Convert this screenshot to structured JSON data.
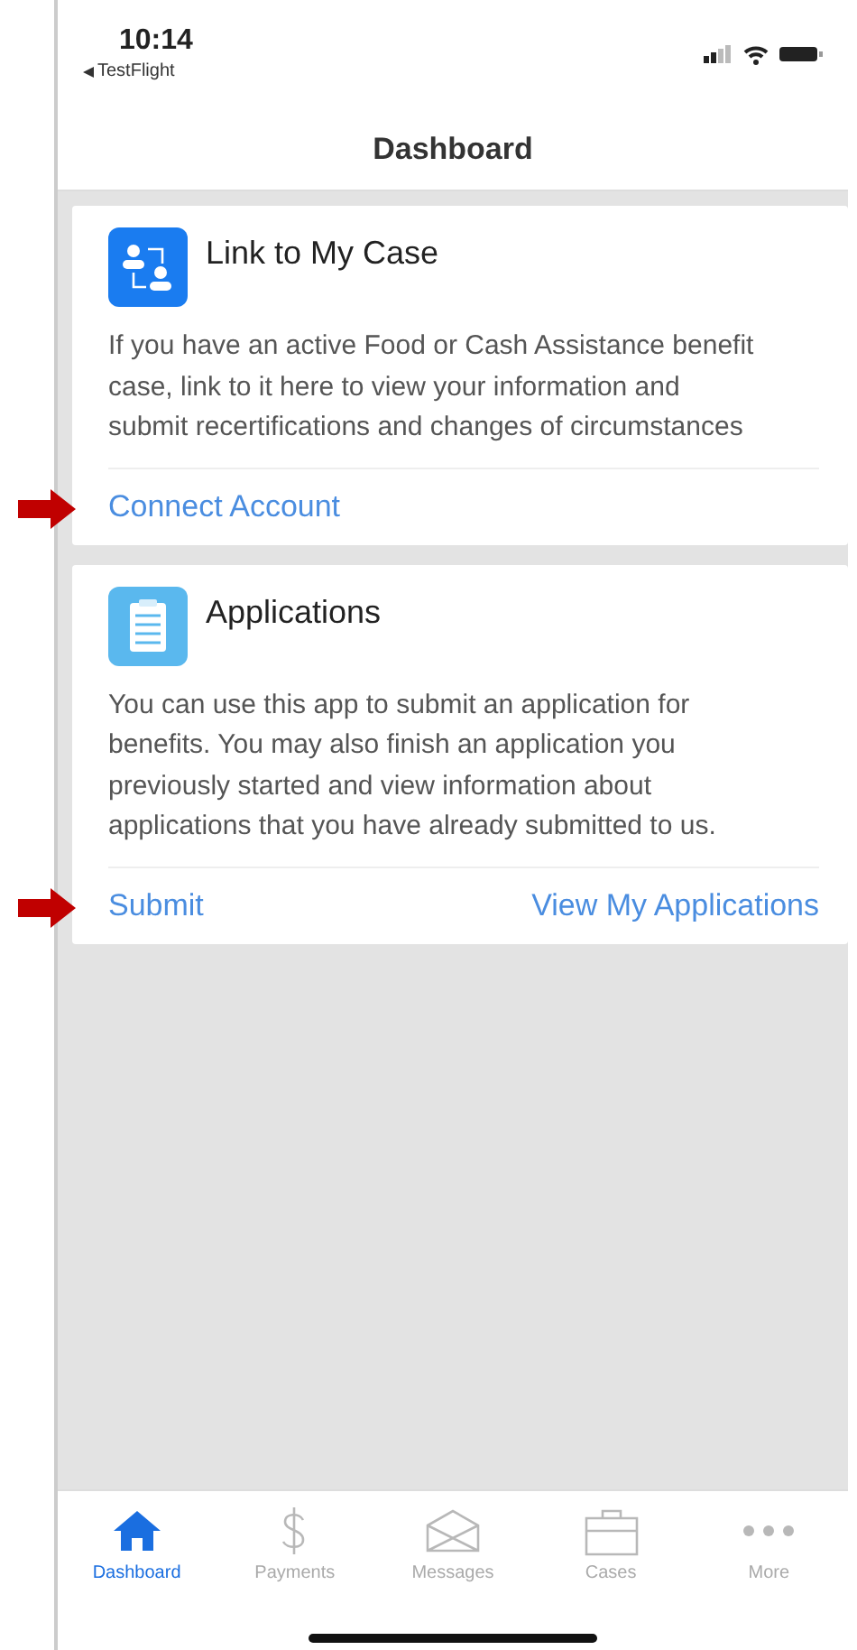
{
  "status_bar": {
    "time": "10:14",
    "back_label": "TestFlight"
  },
  "nav_bar": {
    "title": "Dashboard"
  },
  "cards": [
    {
      "title": "Link to My Case",
      "body": "If you have an active Food or Cash Assistance benefit case, link to it here to view your information and submit recertifications and changes of circumstances",
      "actions": [
        "Connect Account"
      ],
      "pointer_arrow": true
    },
    {
      "title": "Applications",
      "body": "You can use this app to submit an application for benefits. You may also finish an application you previously started and view information about applications that you have already submitted to us.",
      "actions": [
        "Submit",
        "View My Applications"
      ],
      "pointer_arrow": true
    }
  ],
  "tab_bar": [
    {
      "label": "Dashboard",
      "selected": true
    },
    {
      "label": "Payments",
      "selected": false
    },
    {
      "label": "Messages",
      "selected": false
    },
    {
      "label": "Cases",
      "selected": false
    },
    {
      "label": "More",
      "selected": false
    }
  ]
}
